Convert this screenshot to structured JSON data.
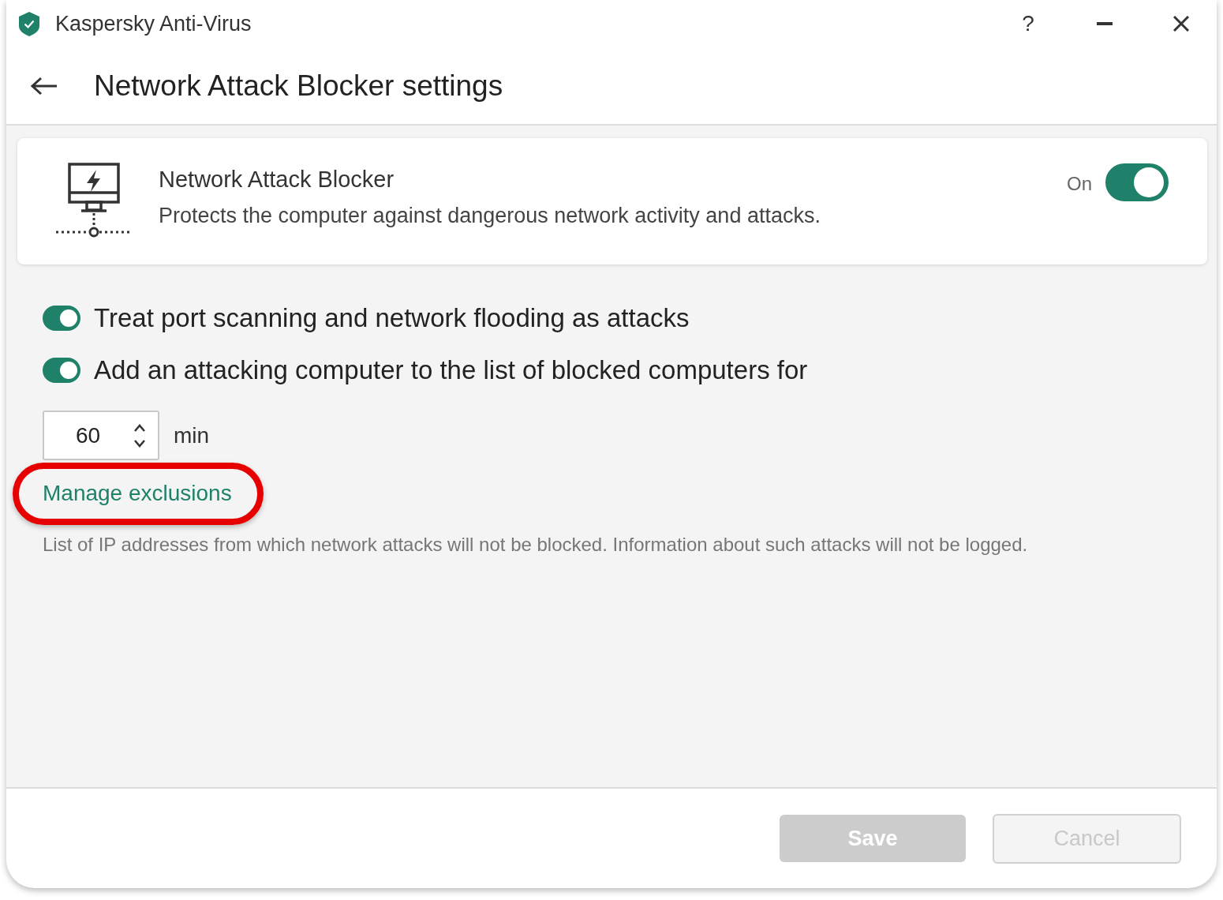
{
  "window": {
    "title": "Kaspersky Anti-Virus",
    "help": "?"
  },
  "header": {
    "title": "Network Attack Blocker settings"
  },
  "component": {
    "name": "Network Attack Blocker",
    "description": "Protects the computer against dangerous network activity and attacks.",
    "status": "On",
    "on": true
  },
  "options": [
    {
      "label": "Treat port scanning and network flooding as attacks",
      "on": true
    },
    {
      "label": "Add an attacking computer to the list of blocked computers for",
      "on": true
    }
  ],
  "block_duration": {
    "value": "60",
    "unit": "min"
  },
  "exclusions": {
    "link": "Manage exclusions",
    "highlighted": true,
    "description": "List of IP addresses from which network attacks will not be blocked. Information about such attacks will not be logged."
  },
  "buttons": [
    {
      "label": "Save",
      "kind": "primary",
      "disabled": true
    },
    {
      "label": "Cancel",
      "kind": "secondary",
      "disabled": true
    }
  ]
}
